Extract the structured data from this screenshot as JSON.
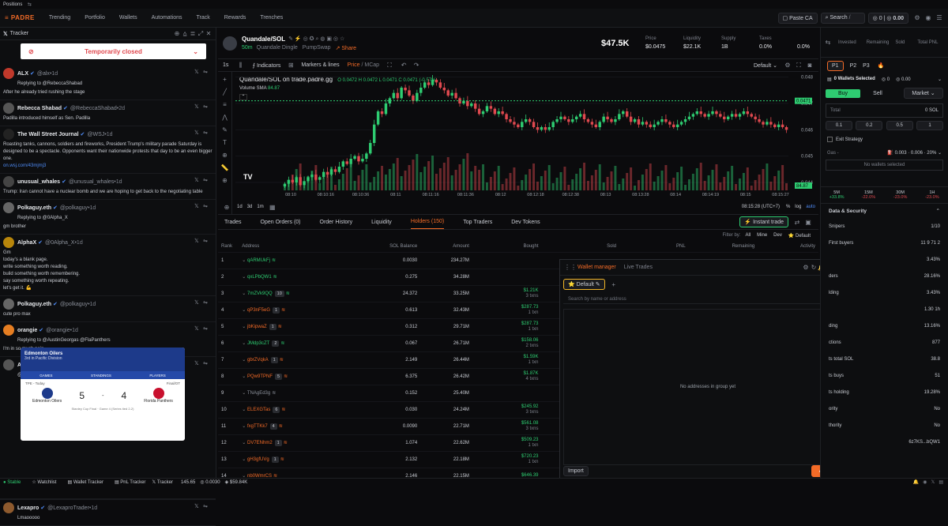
{
  "positions_label": "Positions",
  "nav": {
    "brand": "PADRE",
    "items": [
      "Trending",
      "Portfolio",
      "Wallets",
      "Automations",
      "Track",
      "Rewards",
      "Trenches"
    ],
    "paste_ca": "Paste CA",
    "search": "Search",
    "search_key": "/",
    "balance1": "0",
    "balance2": "0.00"
  },
  "tracker": {
    "title": "Tracker",
    "closed_banner": "Temporarily closed",
    "posts": [
      {
        "name": "ALX",
        "handle": "@alx",
        "time": "1d",
        "reply": "Replying to @RebeccaShabad",
        "text": "After he already tried rushing the stage",
        "color": "#c0392b"
      },
      {
        "name": "Rebecca Shabad",
        "handle": "@RebeccaShabad",
        "time": "2d",
        "reply": "",
        "text": "Padilla introduced himself as Sen. Padilla",
        "color": "#555"
      },
      {
        "name": "The Wall Street Journal",
        "handle": "@WSJ",
        "time": "1d",
        "reply": "",
        "text": "Roasting tanks, cannons, soldiers and fireworks, President Trump's military parade Saturday is designed to be a spectacle. Opponents want their nationwide protests that day to be an even bigger one.",
        "link": "on.wsj.com/43mjmj3",
        "color": "#222"
      },
      {
        "name": "unusual_whales",
        "handle": "@unusual_whales",
        "time": "1d",
        "reply": "",
        "text": "Trump: Iran cannot have a nuclear bomb and we are hoping to get back to the negotiating table",
        "color": "#444"
      },
      {
        "name": "Polkaguy.eth",
        "handle": "@polkaguy",
        "time": "1d",
        "reply": "Replying to @0Alpha_X",
        "text": "gm brother",
        "color": "#666"
      },
      {
        "name": "AlphaX",
        "handle": "@0Alpha_X",
        "time": "1d",
        "reply": "",
        "text": "Gm\ntoday's a blank page.\nwrite something worth reading.\nbuild something worth remembering.\nsay something worth repeating.\nlet's get it. 💪",
        "color": "#b8860b"
      },
      {
        "name": "Polkaguy.eth",
        "handle": "@polkaguy",
        "time": "1d",
        "reply": "",
        "text": "cute pro max",
        "color": "#666"
      },
      {
        "name": "orangie",
        "handle": "@orangie",
        "time": "1d",
        "reply": "Replying to @AustinGeorgas @FlaPanthers",
        "text": "I'm in so much pain",
        "color": "#e67e22"
      },
      {
        "name": "Austin Georgas",
        "handle": "@AustinGeorgas",
        "time": "1d",
        "reply": "",
        "text": "@FlaPanthers",
        "color": "#555"
      },
      {
        "name": "Lexapro",
        "handle": "@LexaproTrader",
        "time": "1d",
        "reply": "",
        "text": "Lmaooooo",
        "color": "#8e5a2e"
      }
    ],
    "card": {
      "team": "Edmonton Oilers",
      "division": "3rd in Pacific Division",
      "tabs": [
        "GAMES",
        "STANDINGS",
        "PLAYERS"
      ],
      "date": "TPE - Today",
      "status": "Final/OT",
      "home": "Edmonton Oilers",
      "home_score": "5",
      "away": "Florida Panthers",
      "away_score": "4",
      "foot": "Stanley Cup Final · Game 4 (Series tied 2-2)"
    }
  },
  "token": {
    "pair": "Quandale/SOL",
    "age": "50m",
    "name": "Quandale Dingle",
    "dex": "PumpSwap",
    "share": "Share",
    "mcap": "$47.5K",
    "stats": [
      {
        "label": "Price",
        "value": "$0.0475"
      },
      {
        "label": "Liquidity",
        "value": "$22.1K"
      },
      {
        "label": "Supply",
        "value": "1B"
      },
      {
        "label": "Taxes",
        "value": "0.0%"
      },
      {
        "label": "",
        "value": "0.0%"
      }
    ]
  },
  "chart_toolbar": {
    "interval": "1s",
    "indicators": "Indicators",
    "markers": "Markers & lines",
    "price_mcap": "Price / MCap",
    "layout": "Default"
  },
  "chart_data": {
    "type": "candlestick",
    "title": "Quandale/SOL on trade.padre.gg",
    "ohlc": "O 0.0472 H 0.0472 L 0.0471 C 0.0471 (-0.57%)",
    "volume_label": "Volume SMA",
    "volume_value": "84.87",
    "y_ticks": [
      "0.048",
      "0.047",
      "0.046",
      "0.045",
      "0.044"
    ],
    "x_ticks": [
      "08:10",
      "08:10:16",
      "08:10:36",
      "08:11",
      "08:11:16",
      "08:11:36",
      "08:12",
      "08:12:18",
      "08:12:38",
      "08:13",
      "08:13:28",
      "08:14",
      "08:14:19",
      "08:15",
      "08:15:27"
    ],
    "ylim": [
      0.0437,
      0.0482
    ],
    "last_price": "0.0471",
    "last_volume": "84.87",
    "closes": [
      0.04395,
      0.0441,
      0.044,
      0.0442,
      0.0439,
      0.04405,
      0.0442,
      0.0443,
      0.0441,
      0.0442,
      0.0444,
      0.0443,
      0.0445,
      0.0444,
      0.0446,
      0.0448,
      0.0447,
      0.0449,
      0.045,
      0.0448,
      0.0449,
      0.0451,
      0.0455,
      0.0462,
      0.0467,
      0.0466,
      0.047,
      0.0472,
      0.0474,
      0.0472,
      0.0476,
      0.0475,
      0.0473,
      0.0471,
      0.0474,
      0.0476,
      0.0478,
      0.0477,
      0.0479,
      0.0478,
      0.0476,
      0.0475,
      0.0473,
      0.0474,
      0.0472,
      0.047,
      0.0471,
      0.0469,
      0.047,
      0.0468,
      0.0466,
      0.0467,
      0.0469,
      0.0468,
      0.0466,
      0.0467,
      0.0466,
      0.0464,
      0.0463,
      0.0462,
      0.0461,
      0.0463,
      0.0464,
      0.0463,
      0.0461,
      0.046,
      0.0461,
      0.046,
      0.0461,
      0.0463,
      0.0464,
      0.0465,
      0.0464,
      0.0463,
      0.0464,
      0.0465,
      0.0466,
      0.0464,
      0.0463,
      0.0462,
      0.0461,
      0.0463,
      0.0465,
      0.0464,
      0.0463,
      0.0464,
      0.0466,
      0.0467,
      0.0465,
      0.0463,
      0.0464,
      0.0462,
      0.0463,
      0.0462,
      0.0461,
      0.0462,
      0.0463,
      0.0464,
      0.0463,
      0.0462,
      0.0461,
      0.0462,
      0.0463,
      0.0464,
      0.0465,
      0.0466,
      0.0467,
      0.0466,
      0.0465,
      0.0466,
      0.0467,
      0.0466,
      0.0465,
      0.0464,
      0.0465,
      0.0466,
      0.0465,
      0.0466,
      0.0467,
      0.0466,
      0.0465,
      0.0464,
      0.0463,
      0.0462,
      0.0463,
      0.0462,
      0.0461,
      0.0462,
      0.0461,
      0.046
    ],
    "clock": "08:15:28 (UTC+7)",
    "pct": "%",
    "log": "log",
    "auto": "auto"
  },
  "tabs": {
    "items": [
      "Trades",
      "Open Orders (0)",
      "Order History",
      "Liquidity",
      "Holders (150)",
      "Top Traders",
      "Dev Tokens"
    ],
    "active": 4,
    "instant": "Instant trade"
  },
  "filters": {
    "label": "Filter by:",
    "items": [
      "All",
      "Mine",
      "Dev",
      "Default"
    ]
  },
  "holders": {
    "columns": [
      "Rank",
      "Address",
      "SOL Balance",
      "Amount",
      "Bought",
      "Sold",
      "PNL",
      "Remaining",
      "Activity"
    ],
    "rows": [
      {
        "rank": "1",
        "addr": "qARMUkFj",
        "sol": "0.0030",
        "amt": "234.27M",
        "b1": "",
        "b2": "",
        "c": "#2ecc71"
      },
      {
        "rank": "2",
        "addr": "qxLPbQW1",
        "sol": "0.275",
        "amt": "34.28M",
        "b1": "",
        "b2": "",
        "c": "#2ecc71"
      },
      {
        "rank": "3",
        "addr": "7mZVk9QQ",
        "sol": "24.372",
        "amt": "33.25M",
        "b1": "$1.21K",
        "b2": "3 txns",
        "c": "#2ecc71",
        "tag": "10"
      },
      {
        "rank": "4",
        "addr": "qP3nF5eG",
        "sol": "0.613",
        "amt": "32.43M",
        "b1": "$287.73",
        "b2": "1 txn",
        "c": "#f36b27",
        "tag": "1"
      },
      {
        "rank": "5",
        "addr": "jbKipwaZ",
        "sol": "0.312",
        "amt": "29.71M",
        "b1": "$287.73",
        "b2": "1 txn",
        "c": "#f36b27",
        "tag": "1"
      },
      {
        "rank": "6",
        "addr": "JMdp3cZT",
        "sol": "0.067",
        "amt": "26.71M",
        "b1": "$158.06",
        "b2": "2 txns",
        "c": "#2ecc71",
        "tag": "2"
      },
      {
        "rank": "7",
        "addr": "gbrZVqkA",
        "sol": "2.149",
        "amt": "26.44M",
        "b1": "$1.59K",
        "b2": "1 txn",
        "c": "#f36b27",
        "tag": "1"
      },
      {
        "rank": "8",
        "addr": "PQw9TPNF",
        "sol": "6.375",
        "amt": "26.42M",
        "b1": "$1.87K",
        "b2": "4 txns",
        "c": "#f36b27",
        "tag": "5"
      },
      {
        "rank": "9",
        "addr": "TNAgEd3g",
        "sol": "0.152",
        "amt": "25.40M",
        "b1": "",
        "b2": "",
        "c": "#8a8f99"
      },
      {
        "rank": "10",
        "addr": "ELEXGTas",
        "sol": "0.030",
        "amt": "24.24M",
        "b1": "$245.92",
        "b2": "3 txns",
        "c": "#f36b27",
        "tag": "6"
      },
      {
        "rank": "11",
        "addr": "fxgTTKk7",
        "sol": "0.0090",
        "amt": "22.71M",
        "b1": "$561.08",
        "b2": "3 txns",
        "c": "#f36b27",
        "tag": "4"
      },
      {
        "rank": "12",
        "addr": "DV7ENhm2",
        "sol": "1.074",
        "amt": "22.62M",
        "b1": "$509.23",
        "b2": "1 txn",
        "c": "#f36b27",
        "tag": "1"
      },
      {
        "rank": "13",
        "addr": "gH3gfUVg",
        "sol": "2.132",
        "amt": "22.18M",
        "b1": "$720.23",
        "b2": "1 txn",
        "c": "#f36b27",
        "tag": "1"
      },
      {
        "rank": "14",
        "addr": "nb0WmrCS",
        "sol": "2.146",
        "amt": "22.15M",
        "b1": "$646.39",
        "b2": "",
        "c": "#f36b27",
        "tag": ""
      }
    ]
  },
  "wallet_manager": {
    "tabs": [
      "Wallet manager",
      "Live Trades"
    ],
    "default": "Default",
    "search_placeholder": "Search by name or address",
    "empty": "No addresses in group yet",
    "import": "Import",
    "add": "Add wallet"
  },
  "right": {
    "top_labels": [
      "Invested",
      "Remaining",
      "Sold",
      "Total PNL"
    ],
    "presets": [
      "P1",
      "P2",
      "P3"
    ],
    "wallets_selected": "0 Wallets Selected",
    "wallet_bal": "0",
    "wallet_bal2": "0.00",
    "buy": "Buy",
    "sell": "Sell",
    "market": "Market",
    "total": "Total",
    "total_unit": "0 SOL",
    "quick": [
      "0.1",
      "0.2",
      "0.5",
      "1"
    ],
    "exit": "Exit Strategy",
    "gas": "Gas -",
    "gas_vals": [
      "0.003",
      "0.006",
      "20%"
    ],
    "no_wallets": "No wallets selected",
    "timeframes": [
      {
        "t": "5M",
        "v": "+33.8%",
        "c": "#2ecc71"
      },
      {
        "t": "15M",
        "v": "-22.0%",
        "c": "#e0494f"
      },
      {
        "t": "30M",
        "v": "-23.0%",
        "c": "#e0494f"
      },
      {
        "t": "1H",
        "v": "-23.0%",
        "c": "#e0494f"
      }
    ],
    "ds_title": "Data & Security",
    "ds_rows": [
      {
        "k": "Snipers",
        "v": "1/10"
      },
      {
        "k": "First buyers",
        "v": "11 9 71 2"
      },
      {
        "k": "",
        "v": "3.43%"
      },
      {
        "k": "ders",
        "v": "28.16%"
      },
      {
        "k": "lding",
        "v": "3.43%"
      },
      {
        "k": "",
        "v": "1.30  1h"
      },
      {
        "k": "ding",
        "v": "13.16%"
      },
      {
        "k": "ctions",
        "v": "877"
      },
      {
        "k": "ts total SOL",
        "v": "38.8"
      },
      {
        "k": "ts buys",
        "v": "51"
      },
      {
        "k": "ts holding",
        "v": "19.28%"
      },
      {
        "k": "ority",
        "v": "No"
      },
      {
        "k": "thority",
        "v": "No"
      },
      {
        "k": "",
        "v": "6z7KS...bQW1"
      }
    ]
  },
  "status": {
    "items": [
      "Stable",
      "Watchlist",
      "Wallet Tracker",
      "PnL Tracker",
      "Tracker"
    ],
    "v1": "145.65",
    "v2": "0.0030",
    "v3": "$59.84K"
  }
}
